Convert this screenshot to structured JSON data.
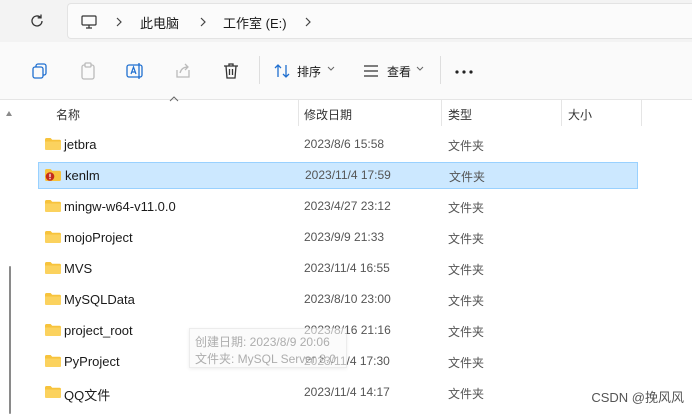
{
  "address": {
    "breadcrumbs": [
      "此电脑",
      "工作室 (E:)"
    ]
  },
  "toolbar": {
    "sort_label": "排序",
    "view_label": "查看"
  },
  "columns": {
    "name": "名称",
    "date": "修改日期",
    "type": "类型",
    "size": "大小"
  },
  "files": [
    {
      "name": "jetbra",
      "date": "2023/8/6 15:58",
      "type": "文件夹",
      "icon": "folder-icon"
    },
    {
      "name": "kenlm",
      "date": "2023/11/4 17:59",
      "type": "文件夹",
      "icon": "folder-warning-icon",
      "selected": true
    },
    {
      "name": "mingw-w64-v11.0.0",
      "date": "2023/4/27 23:12",
      "type": "文件夹",
      "icon": "folder-icon"
    },
    {
      "name": "mojoProject",
      "date": "2023/9/9 21:33",
      "type": "文件夹",
      "icon": "folder-icon"
    },
    {
      "name": "MVS",
      "date": "2023/11/4 16:55",
      "type": "文件夹",
      "icon": "folder-icon"
    },
    {
      "name": "MySQLData",
      "date": "2023/8/10 23:00",
      "type": "文件夹",
      "icon": "folder-icon"
    },
    {
      "name": "project_root",
      "date": "2023/8/16 21:16",
      "type": "文件夹",
      "icon": "folder-icon"
    },
    {
      "name": "PyProject",
      "date": "2023/11/4 17:30",
      "type": "文件夹",
      "icon": "folder-icon"
    },
    {
      "name": "QQ文件",
      "date": "2023/11/4 14:17",
      "type": "文件夹",
      "icon": "folder-icon"
    }
  ],
  "tooltip": {
    "line1": "创建日期: 2023/8/9 20:06",
    "line2": "文件夹: MySQL Server 8.0"
  },
  "watermark": "CSDN @挽风风",
  "colors": {
    "selection_bg": "#cce8ff",
    "selection_border": "#99d1ff",
    "folder": "#f7c33c"
  }
}
